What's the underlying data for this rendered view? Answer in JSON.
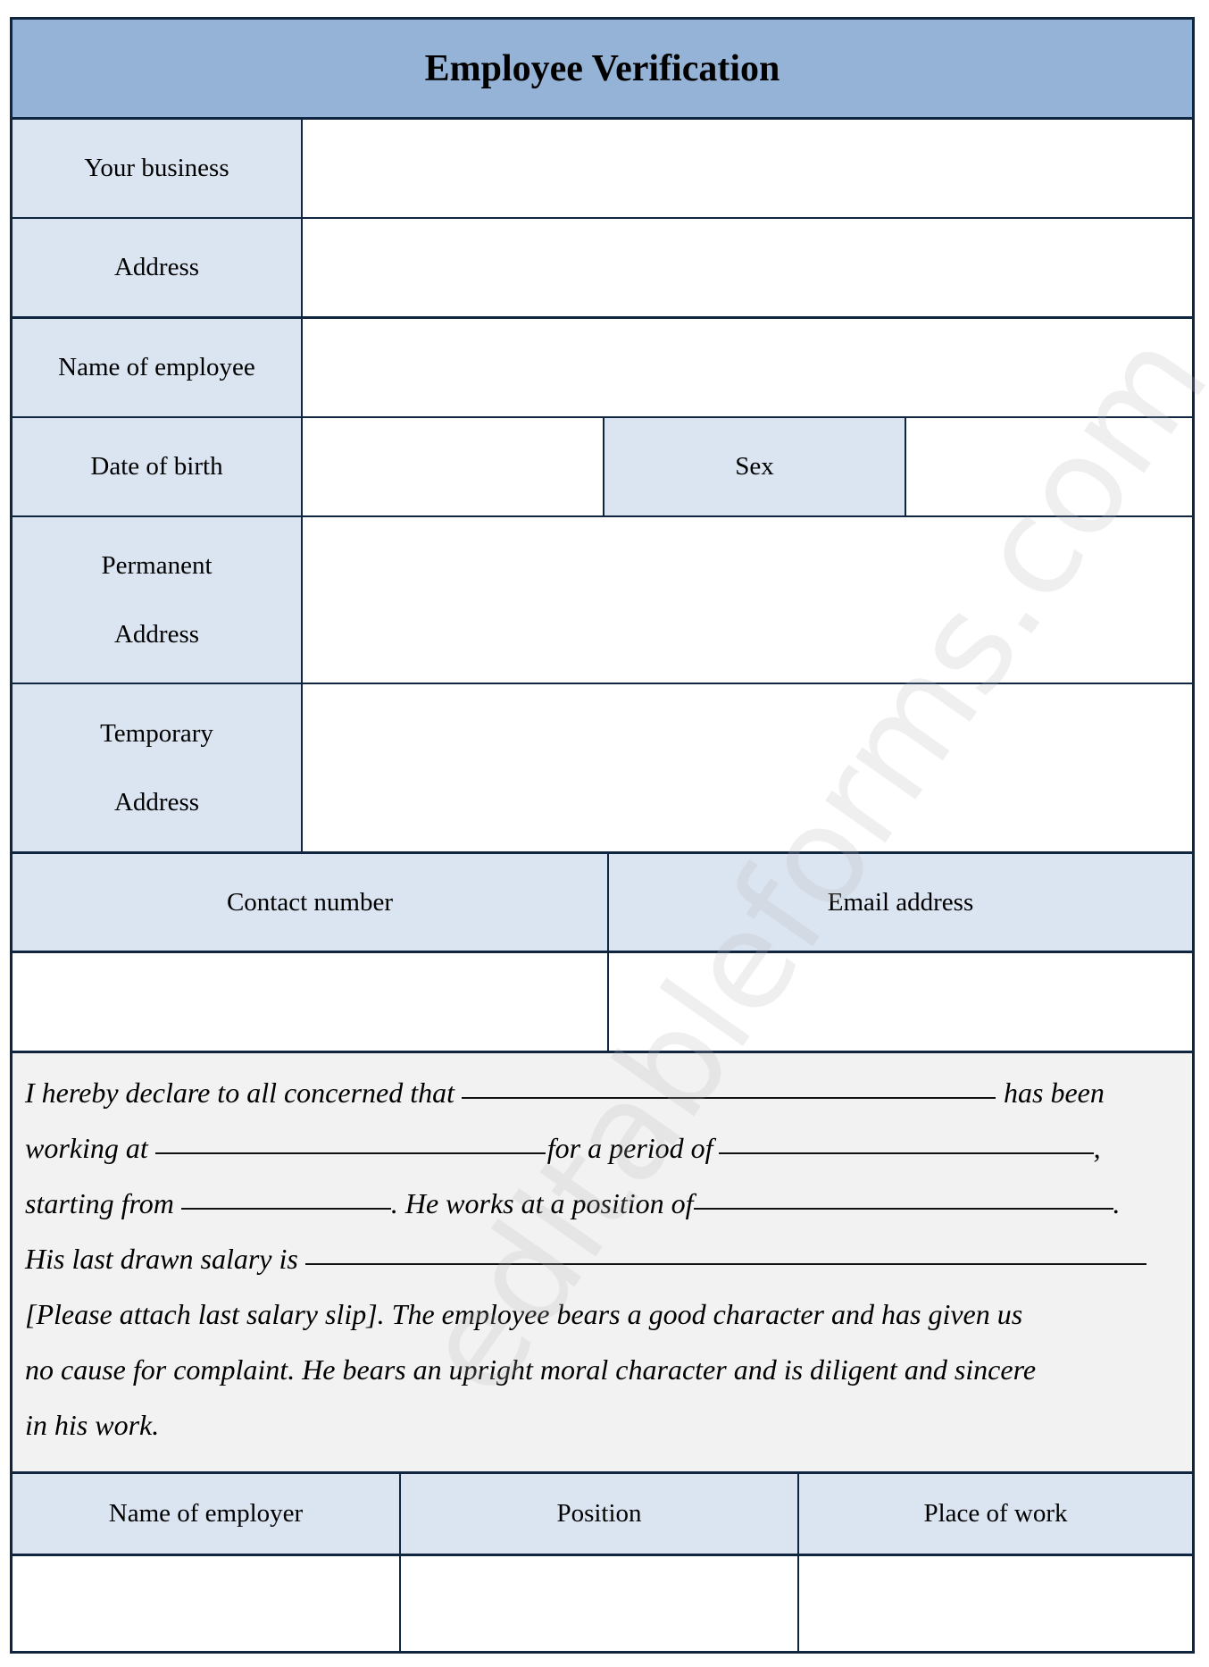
{
  "form": {
    "title": "Employee Verification",
    "fields": {
      "your_business": {
        "label": "Your business",
        "value": ""
      },
      "address": {
        "label": "Address",
        "value": ""
      },
      "name_of_employee": {
        "label": "Name of employee",
        "value": ""
      },
      "date_of_birth": {
        "label": "Date of birth",
        "value": ""
      },
      "sex": {
        "label": "Sex",
        "value": ""
      },
      "permanent_address": {
        "label_line1": "Permanent",
        "label_line2": "Address",
        "value": ""
      },
      "temporary_address": {
        "label_line1": "Temporary",
        "label_line2": "Address",
        "value": ""
      },
      "contact_number": {
        "label": "Contact number",
        "value": ""
      },
      "email_address": {
        "label": "Email address",
        "value": ""
      }
    },
    "declaration": {
      "line1_a": "I hereby declare to all concerned that",
      "line1_b": "has been",
      "line2_a": "working at",
      "line2_b": "for a period of",
      "line2_c": ",",
      "line3_a": "starting from",
      "line3_b": ". He works at a position of",
      "line3_c": ".",
      "line4_a": "His last drawn salary is",
      "line5": "[Please attach last salary slip]. The employee bears a good character and has given us",
      "line6": "no cause for complaint. He bears an upright moral character and is diligent and sincere",
      "line7": "in his work."
    },
    "employer_table": {
      "headers": [
        "Name of employer",
        "Position",
        "Place of work"
      ],
      "values": [
        "",
        "",
        ""
      ]
    }
  },
  "watermark": "editableforms.com",
  "colors": {
    "header_bg": "#95b3d7",
    "label_bg": "#dbe5f1",
    "paragraph_bg": "#f2f2f2",
    "border": "#0f2540"
  }
}
